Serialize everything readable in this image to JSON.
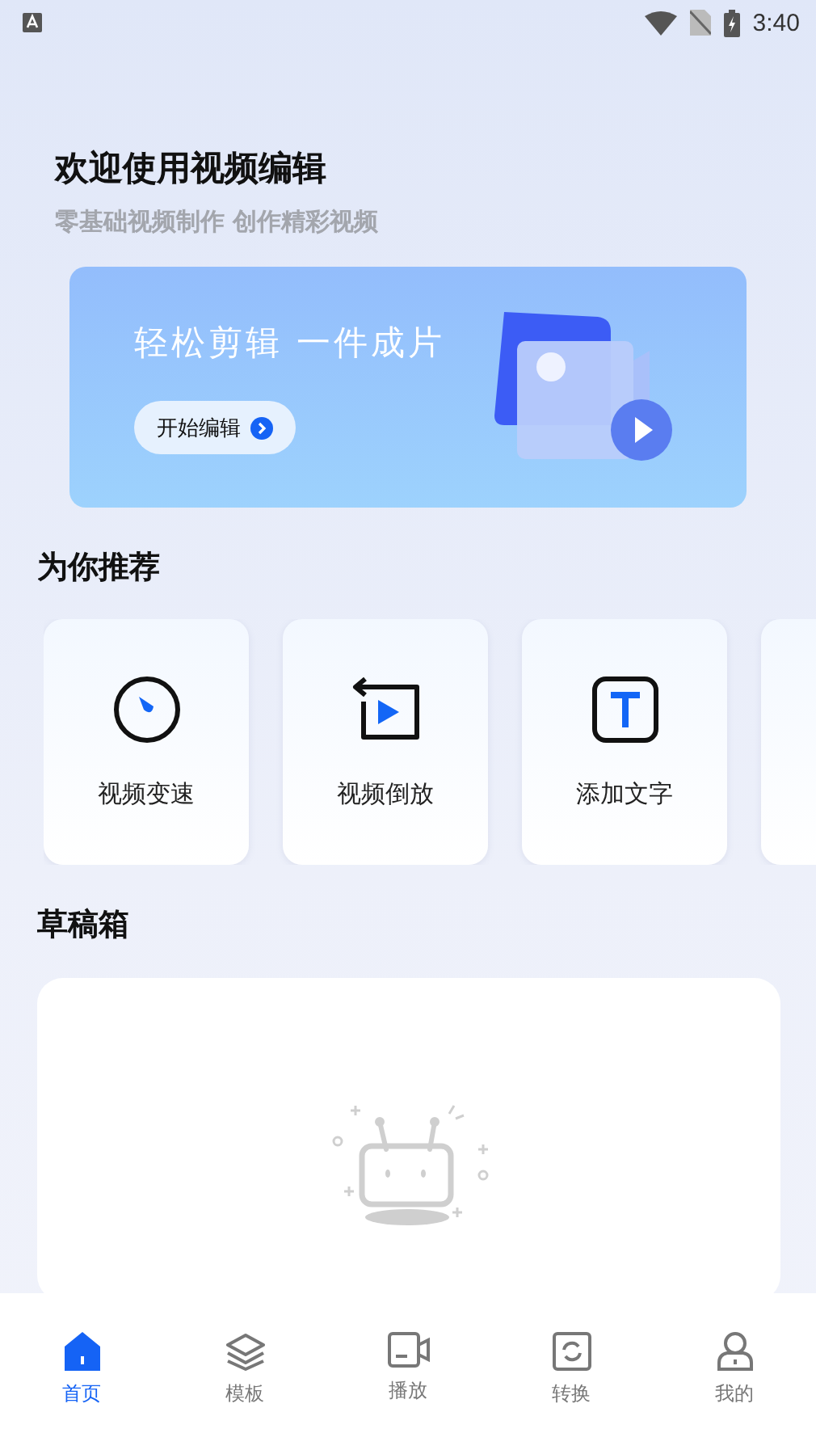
{
  "status_bar": {
    "time": "3:40"
  },
  "header": {
    "title": "欢迎使用视频编辑",
    "subtitle": "零基础视频制作 创作精彩视频"
  },
  "banner": {
    "headline": "轻松剪辑 一件成片",
    "button": "开始编辑"
  },
  "recommend": {
    "title": "为你推荐",
    "tools": [
      {
        "kind": "speed",
        "label": "视频变速"
      },
      {
        "kind": "reverse",
        "label": "视频倒放"
      },
      {
        "kind": "text",
        "label": "添加文字"
      },
      {
        "kind": "partial"
      }
    ]
  },
  "drafts": {
    "title": "草稿箱"
  },
  "nav": [
    {
      "kind": "home",
      "label": "首页",
      "selected": true
    },
    {
      "kind": "template",
      "label": "模板",
      "selected": false
    },
    {
      "kind": "play",
      "label": "播放",
      "selected": false
    },
    {
      "kind": "convert",
      "label": "转换",
      "selected": false
    },
    {
      "kind": "profile",
      "label": "我的",
      "selected": false
    }
  ]
}
